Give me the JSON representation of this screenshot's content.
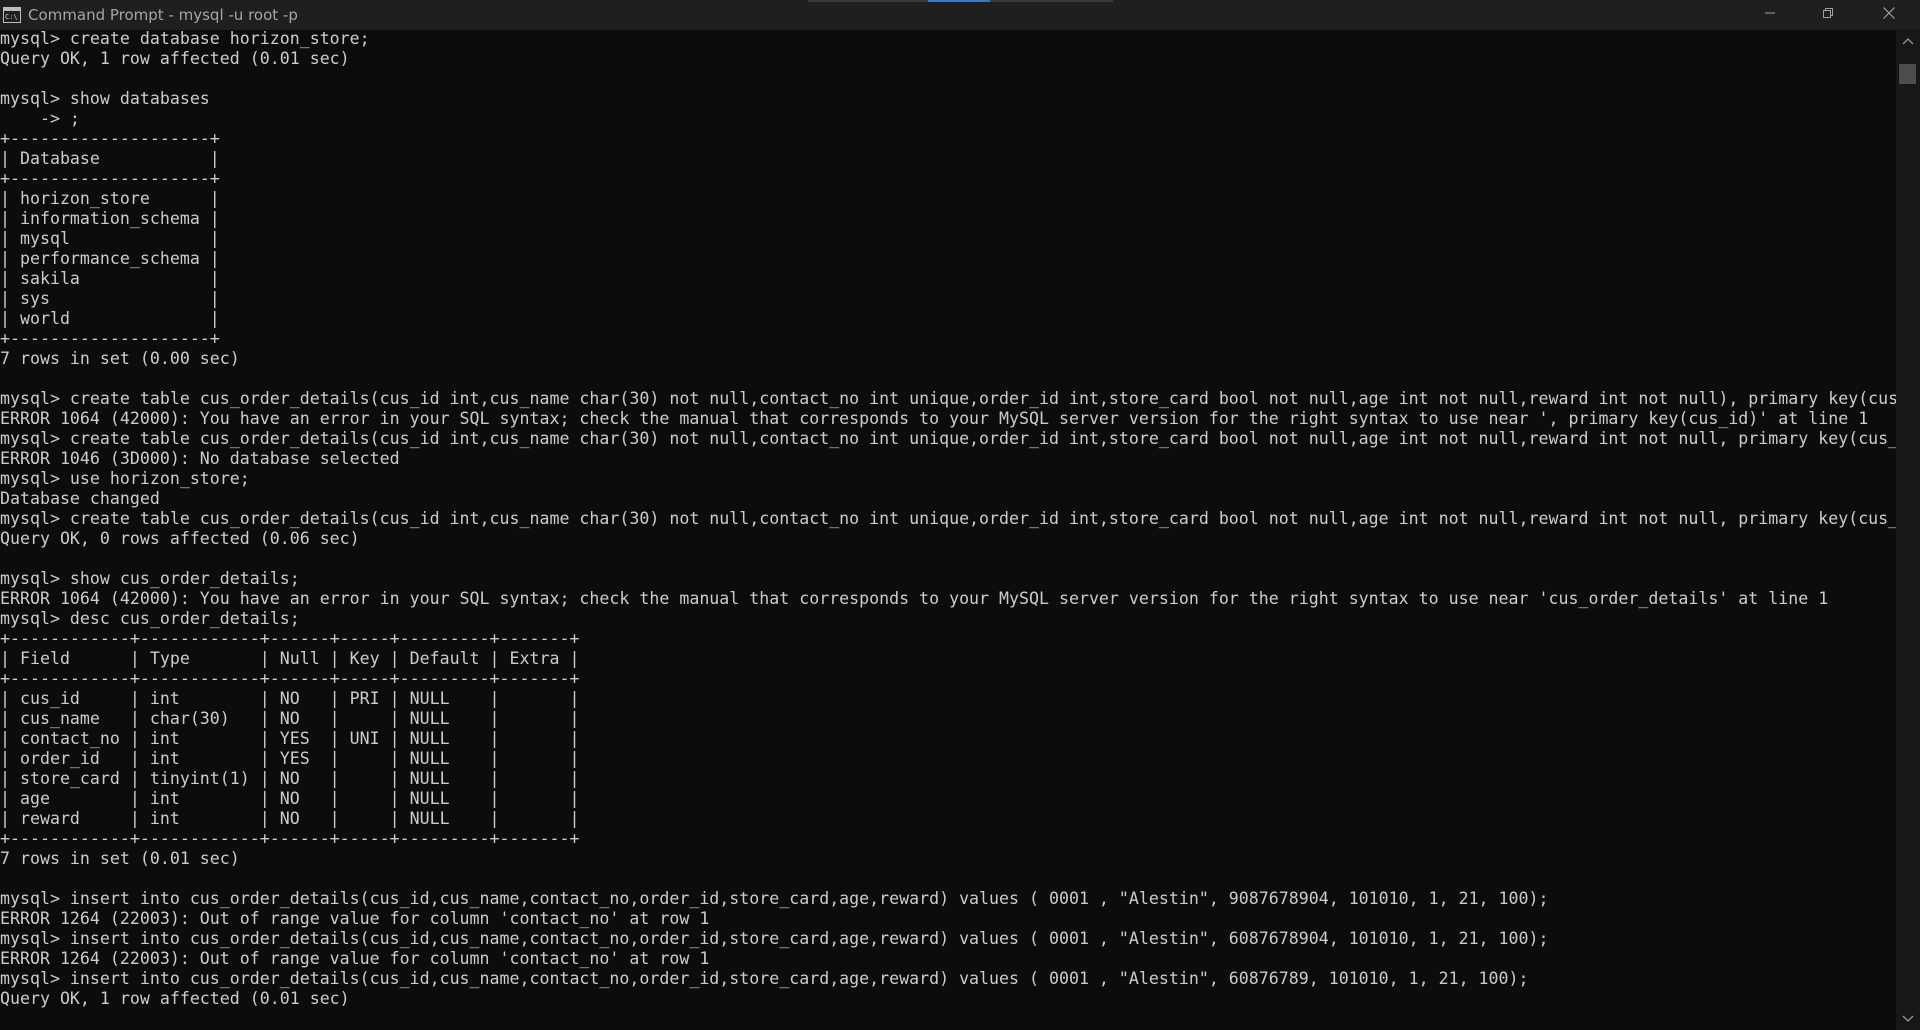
{
  "window": {
    "title": "Command Prompt - mysql  -u root -p",
    "icons": {
      "app": "cmd-icon",
      "minimize": "minimize-icon",
      "maximize": "restore-icon",
      "close": "close-icon"
    }
  },
  "scrollbar": {
    "up": "scroll-up-arrow-icon",
    "down": "scroll-down-arrow-icon"
  },
  "colors": {
    "background": "#0c0c0c",
    "text": "#cccccc",
    "titlebar": "#1f1f1f",
    "accent": "#3a78c8"
  },
  "terminal": {
    "lines": [
      "mysql> create database horizon_store;",
      "Query OK, 1 row affected (0.01 sec)",
      "",
      "mysql> show databases",
      "    -> ;",
      "+--------------------+",
      "| Database           |",
      "+--------------------+",
      "| horizon_store      |",
      "| information_schema |",
      "| mysql              |",
      "| performance_schema |",
      "| sakila             |",
      "| sys                |",
      "| world              |",
      "+--------------------+",
      "7 rows in set (0.00 sec)",
      "",
      "mysql> create table cus_order_details(cus_id int,cus_name char(30) not null,contact_no int unique,order_id int,store_card bool not null,age int not null,reward int not null), primary key(cus_id);",
      "ERROR 1064 (42000): You have an error in your SQL syntax; check the manual that corresponds to your MySQL server version for the right syntax to use near ', primary key(cus_id)' at line 1",
      "mysql> create table cus_order_details(cus_id int,cus_name char(30) not null,contact_no int unique,order_id int,store_card bool not null,age int not null,reward int not null, primary key(cus_id));",
      "ERROR 1046 (3D000): No database selected",
      "mysql> use horizon_store;",
      "Database changed",
      "mysql> create table cus_order_details(cus_id int,cus_name char(30) not null,contact_no int unique,order_id int,store_card bool not null,age int not null,reward int not null, primary key(cus_id));",
      "Query OK, 0 rows affected (0.06 sec)",
      "",
      "mysql> show cus_order_details;",
      "ERROR 1064 (42000): You have an error in your SQL syntax; check the manual that corresponds to your MySQL server version for the right syntax to use near 'cus_order_details' at line 1",
      "mysql> desc cus_order_details;",
      "+------------+------------+------+-----+---------+-------+",
      "| Field      | Type       | Null | Key | Default | Extra |",
      "+------------+------------+------+-----+---------+-------+",
      "| cus_id     | int        | NO   | PRI | NULL    |       |",
      "| cus_name   | char(30)   | NO   |     | NULL    |       |",
      "| contact_no | int        | YES  | UNI | NULL    |       |",
      "| order_id   | int        | YES  |     | NULL    |       |",
      "| store_card | tinyint(1) | NO   |     | NULL    |       |",
      "| age        | int        | NO   |     | NULL    |       |",
      "| reward     | int        | NO   |     | NULL    |       |",
      "+------------+------------+------+-----+---------+-------+",
      "7 rows in set (0.01 sec)",
      "",
      "mysql> insert into cus_order_details(cus_id,cus_name,contact_no,order_id,store_card,age,reward) values ( 0001 , \"Alestin\", 9087678904, 101010, 1, 21, 100);",
      "ERROR 1264 (22003): Out of range value for column 'contact_no' at row 1",
      "mysql> insert into cus_order_details(cus_id,cus_name,contact_no,order_id,store_card,age,reward) values ( 0001 , \"Alestin\", 6087678904, 101010, 1, 21, 100);",
      "ERROR 1264 (22003): Out of range value for column 'contact_no' at row 1",
      "mysql> insert into cus_order_details(cus_id,cus_name,contact_no,order_id,store_card,age,reward) values ( 0001 , \"Alestin\", 60876789, 101010, 1, 21, 100);",
      "Query OK, 1 row affected (0.01 sec)"
    ]
  }
}
